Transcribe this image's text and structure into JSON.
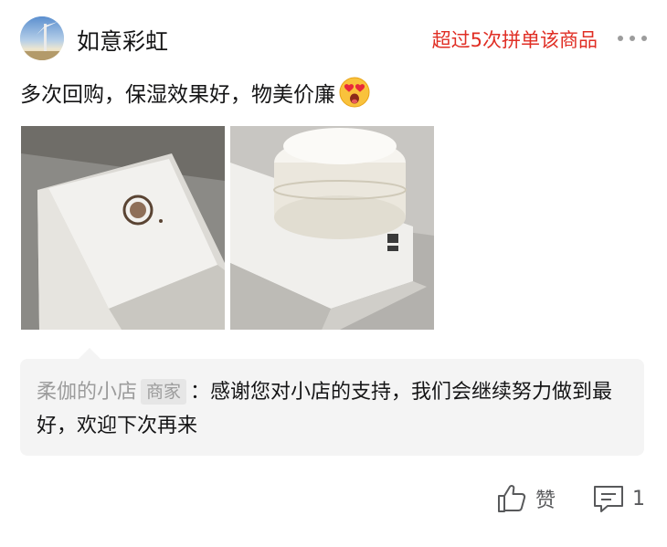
{
  "review": {
    "username": "如意彩虹",
    "repurchase_badge": "超过5次拼单该商品",
    "more_icon": "ellipsis-icon",
    "text": "多次回购，保湿效果好，物美价廉",
    "emoji": "heart-eyes-emoji",
    "photos": [
      {
        "name": "product-box-photo"
      },
      {
        "name": "product-jar-photo"
      }
    ]
  },
  "reply": {
    "shop_name": "柔伽的小店",
    "badge": "商家",
    "separator": "：",
    "text": "感谢您对小店的支持，我们会继续努力做到最好，欢迎下次再来"
  },
  "actions": {
    "like_label": "赞",
    "comment_count": "1"
  },
  "colors": {
    "accent_red": "#e02e24",
    "muted_gray": "#9c9c9c",
    "reply_bg": "#f4f4f4"
  }
}
